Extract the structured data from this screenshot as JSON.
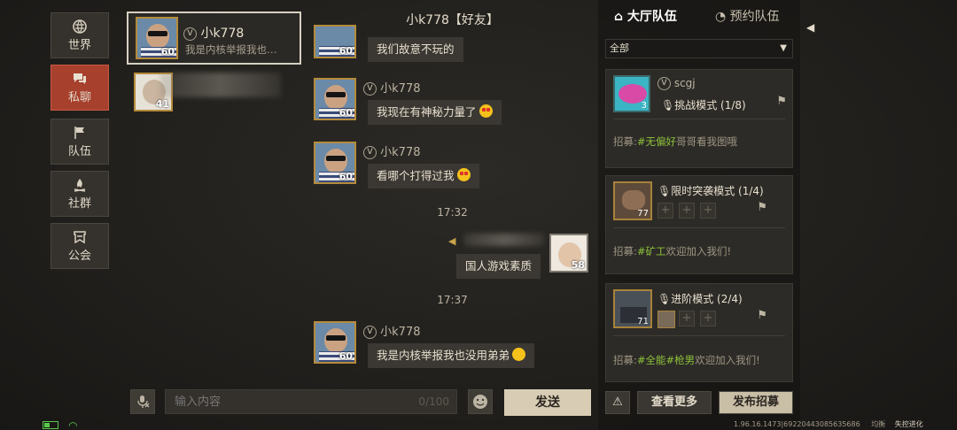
{
  "sidebar": {
    "items": [
      {
        "label": "世界",
        "icon": "globe-icon"
      },
      {
        "label": "私聊",
        "icon": "chat-bubbles-icon",
        "active": true
      },
      {
        "label": "队伍",
        "icon": "flag-icon"
      },
      {
        "label": "社群",
        "icon": "campfire-icon"
      },
      {
        "label": "公会",
        "icon": "banner-icon"
      }
    ]
  },
  "chat_list": [
    {
      "name": "小k778",
      "preview": "我是内核举报我也…",
      "level": "60",
      "active": true
    },
    {
      "name": "",
      "preview": "",
      "level": "41",
      "active": false
    }
  ],
  "chat": {
    "title": "小k778【好友】",
    "messages": [
      {
        "sender": "小k778",
        "level": "60",
        "text": "我们故意不玩的"
      },
      {
        "sender": "小k778",
        "level": "60",
        "text": "我现在有神秘力量了"
      },
      {
        "sender": "小k778",
        "level": "60",
        "text": "看哪个打得过我"
      },
      {
        "time": "17:32"
      },
      {
        "sender": "me",
        "level": "58",
        "text": "国人游戏素质"
      },
      {
        "time": "17:37"
      },
      {
        "sender": "小k778",
        "level": "60",
        "text": "我是内核举报我也没用弟弟"
      }
    ]
  },
  "input": {
    "placeholder": "输入内容",
    "counter": "0/100",
    "send_label": "发送"
  },
  "teams": {
    "tabs": [
      "大厅队伍",
      "预约队伍"
    ],
    "filter": "全部",
    "cards": [
      {
        "leader": "scgj",
        "mode": "挑战模式 (1/8)",
        "recruit_prefix": "招募:",
        "tag": "#无偏好",
        "recruit_suffix": "哥哥看我图哦",
        "level": "3"
      },
      {
        "mode": "限时突袭模式 (1/4)",
        "recruit_prefix": "招募:",
        "tag": "#矿工",
        "recruit_suffix": "欢迎加入我们!",
        "level": "77"
      },
      {
        "mode": "进阶模式 (2/4)",
        "recruit_prefix": "招募:",
        "tag": "#全能#枪男",
        "recruit_suffix": "欢迎加入我们!",
        "level": "71"
      }
    ],
    "see_more": "查看更多",
    "post_recruit": "发布招募"
  },
  "footer": {
    "version": "1.96.16.1473|69220443085635686",
    "balance_label": "均衡",
    "brand": "失控进化"
  },
  "colors": {
    "active_nav": "#a8402e",
    "tag_green": "#8cc23a",
    "send_button": "#d8cdb4"
  }
}
